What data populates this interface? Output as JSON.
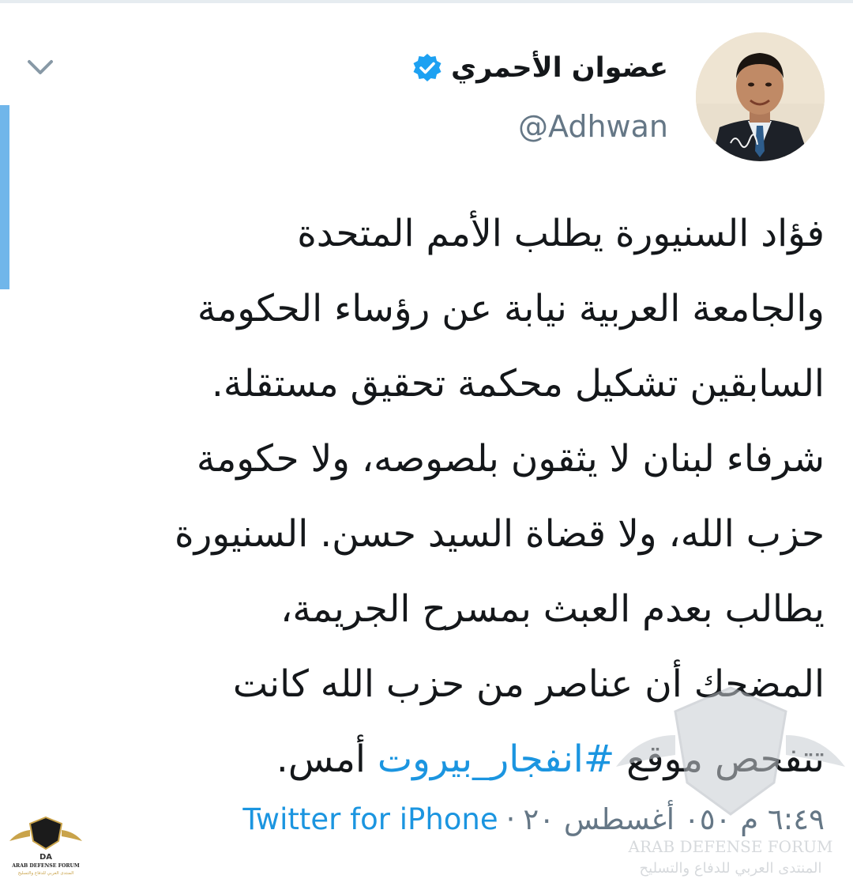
{
  "tweet": {
    "author": {
      "display_name": "عضوان الأحمري",
      "handle": "@Adhwan",
      "verified": true
    },
    "text_lines": [
      "فؤاد السنيورة يطلب الأمم المتحدة",
      "والجامعة العربية نيابة عن رؤساء الحكومة",
      "السابقين تشكيل محكمة تحقيق مستقلة.",
      "شرفاء لبنان لا يثقون بلصوصه، ولا حكومة",
      "حزب الله، ولا قضاة السيد حسن. السنيورة",
      "يطالب بعدم العبث بمسرح الجريمة،",
      "المضحك أن عناصر من حزب الله كانت"
    ],
    "last_line": {
      "before": "تتفحص موقع ",
      "hashtag": "#انفجار_بيروت",
      "after": " أمس."
    },
    "timestamp": "٦:٤٩ م ٠٥٠ أغسطس ٢٠",
    "separator": "·",
    "source": "Twitter for iPhone"
  },
  "watermark": {
    "text_en": "ARAB DEFENSE FORUM",
    "text_ar": "المنتدى العربي للدفاع والتسليح",
    "logo_letters": "DA"
  },
  "icons": {
    "verified": "verified-badge-icon",
    "chevron": "chevron-down-icon"
  },
  "colors": {
    "link": "#1b95e0",
    "secondary": "#657786",
    "text": "#14171a",
    "verified": "#1da1f2",
    "accent_bar": "#70b6ea"
  }
}
